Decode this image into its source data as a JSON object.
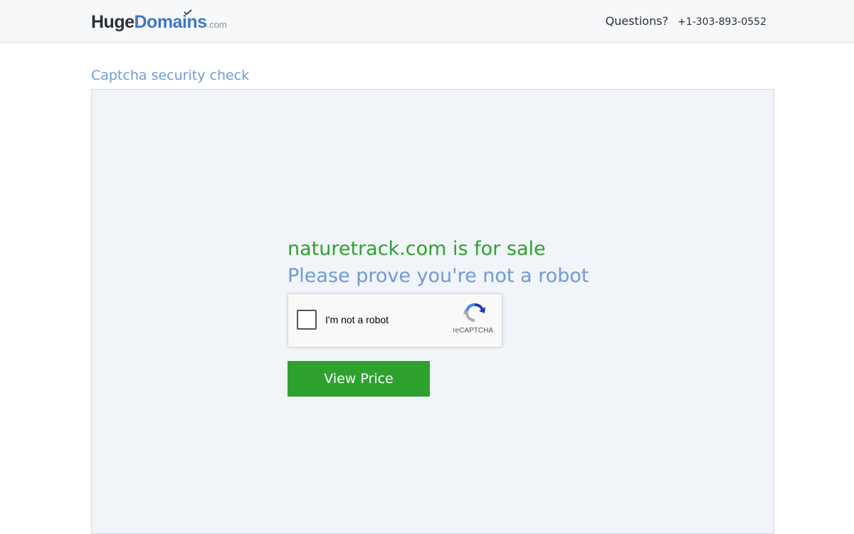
{
  "header": {
    "logo": {
      "huge": "Huge",
      "domains": "Domains",
      "tld": ".com"
    },
    "questions_label": "Questions?",
    "phone": "+1-303-893-0552"
  },
  "page_title": "Captcha security check",
  "main": {
    "for_sale_text": "naturetrack.com is for sale",
    "prove_text": "Please prove you're not a robot",
    "recaptcha": {
      "label": "I'm not a robot",
      "brand": "reCAPTCHA",
      "checked": false
    },
    "view_price_label": "View Price"
  },
  "colors": {
    "brand_blue": "#3f78c4",
    "accent_green": "#2ea12f",
    "light_blue_text": "#6f9ad6",
    "panel_bg": "#f1f4f8"
  },
  "icons": [
    "checkmark-icon",
    "recaptcha-logo-icon",
    "checkbox"
  ]
}
